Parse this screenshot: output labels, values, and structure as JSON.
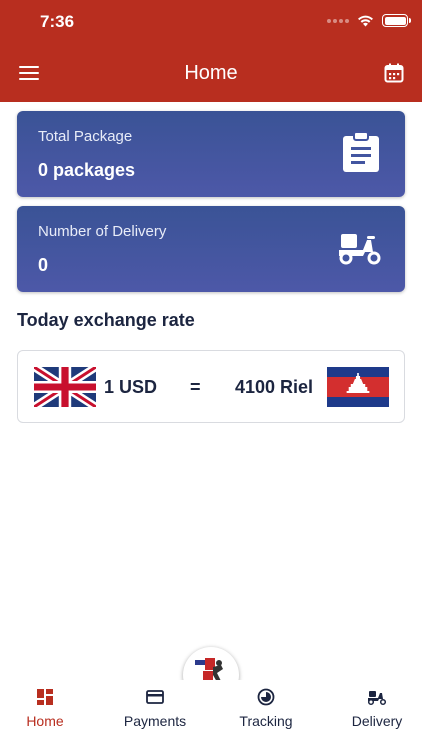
{
  "status_bar": {
    "time": "7:36"
  },
  "header": {
    "title": "Home",
    "menu_icon": "menu-icon",
    "calendar_icon": "calendar-icon"
  },
  "cards": [
    {
      "label": "Total Package",
      "value": "0 packages",
      "icon": "clipboard-icon"
    },
    {
      "label": "Number of Delivery",
      "value": "0",
      "icon": "scooter-icon"
    }
  ],
  "exchange": {
    "title": "Today exchange rate",
    "from": "1 USD",
    "equals": "=",
    "to": "4100 Riel",
    "from_flag": "uk-flag-icon",
    "to_flag": "cambodia-flag-icon"
  },
  "nav": {
    "items": [
      {
        "label": "Home",
        "icon": "home-grid-icon",
        "active": true
      },
      {
        "label": "Payments",
        "icon": "credit-card-icon",
        "active": false
      },
      {
        "label": "Tracking",
        "icon": "tracking-icon",
        "active": false
      },
      {
        "label": "Delivery",
        "icon": "scooter-icon",
        "active": false
      }
    ],
    "center_button_icon": "delivery-logo-icon"
  },
  "colors": {
    "header": "#b82e1f",
    "card": "#4255a0",
    "text": "#1c2540",
    "active": "#b82e1f"
  }
}
